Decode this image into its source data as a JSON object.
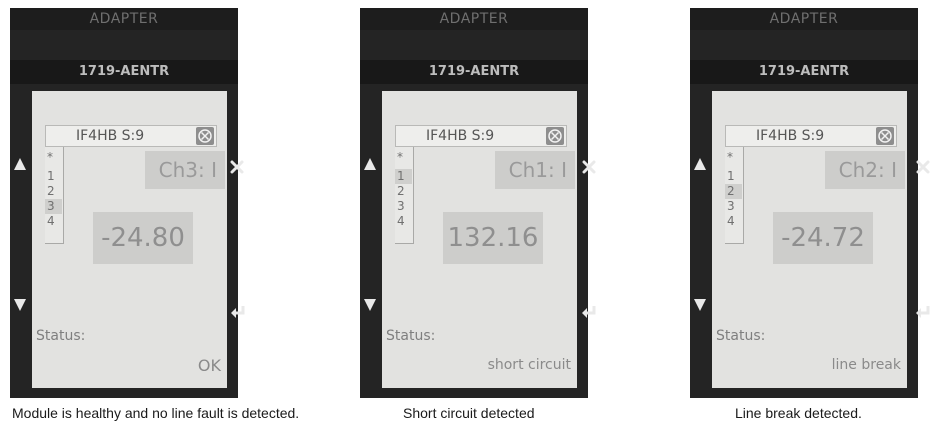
{
  "panels": [
    {
      "adapter_label": "ADAPTER",
      "module_label": "1719-AENTR",
      "title": "IF4HB S:9",
      "channel_list": [
        "*",
        "1",
        "2",
        "3",
        "4"
      ],
      "selected_channel": "3",
      "channel_label": "Ch3: I",
      "value": "-24.80",
      "status_label": "Status:",
      "status_value": "OK",
      "caption": "Module is healthy and no line fault is detected."
    },
    {
      "adapter_label": "ADAPTER",
      "module_label": "1719-AENTR",
      "title": "IF4HB S:9",
      "channel_list": [
        "*",
        "1",
        "2",
        "3",
        "4"
      ],
      "selected_channel": "1",
      "channel_label": "Ch1: I",
      "value": "132.16",
      "status_label": "Status:",
      "status_value": "short circuit",
      "caption": "Short circuit detected"
    },
    {
      "adapter_label": "ADAPTER",
      "module_label": "1719-AENTR",
      "title": "IF4HB S:9",
      "channel_list": [
        "*",
        "1",
        "2",
        "3",
        "4"
      ],
      "selected_channel": "2",
      "channel_label": "Ch2: I",
      "value": "-24.72",
      "status_label": "Status:",
      "status_value": "line break",
      "caption": "Line break detected."
    }
  ],
  "icons": {
    "up": "up-arrow-icon",
    "down": "down-arrow-icon",
    "close": "close-icon",
    "enter": "enter-icon",
    "title_close": "circle-close-icon"
  },
  "colors": {
    "device_body": "#242424",
    "screen_background": "#e2e2e0",
    "field_background": "#cdcdcb"
  }
}
